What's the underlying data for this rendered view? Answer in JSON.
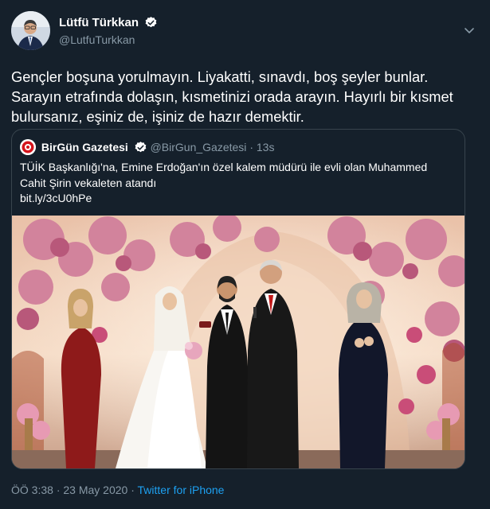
{
  "author": {
    "name": "Lütfü Türkkan",
    "handle": "@LutfuTurkkan"
  },
  "tweet": {
    "lines": [
      "Gençler boşuna yorulmayın. Liyakatti, sınavdı, boş şeyler bunlar.",
      "Sarayın etrafında dolaşın, kısmetinizi orada arayın. Hayırlı bir kısmet",
      "bulursanız, eşiniz de, işiniz de hazır demektir."
    ]
  },
  "quoted": {
    "name": "BirGün Gazetesi",
    "handle": "@BirGun_Gazetesi",
    "separator": "·",
    "time": "13s",
    "lines": [
      "TÜİK Başkanlığı'na, Emine Erdoğan'ın özel kalem müdürü ile evli olan Muhammed",
      "Cahit Şirin vekaleten atandı",
      "bit.ly/3cU0hPe"
    ]
  },
  "footer": {
    "time": "ÖÖ 3:38",
    "separator": "·",
    "date": "23 May 2020",
    "separator2": "·",
    "source": "Twitter for iPhone"
  },
  "colors": {
    "background": "#15202b",
    "muted": "#8899a6",
    "link": "#1da1f2",
    "verified": "#ffffff"
  },
  "icons": {
    "verified": "verified-badge-icon",
    "chevron": "chevron-down-icon"
  }
}
